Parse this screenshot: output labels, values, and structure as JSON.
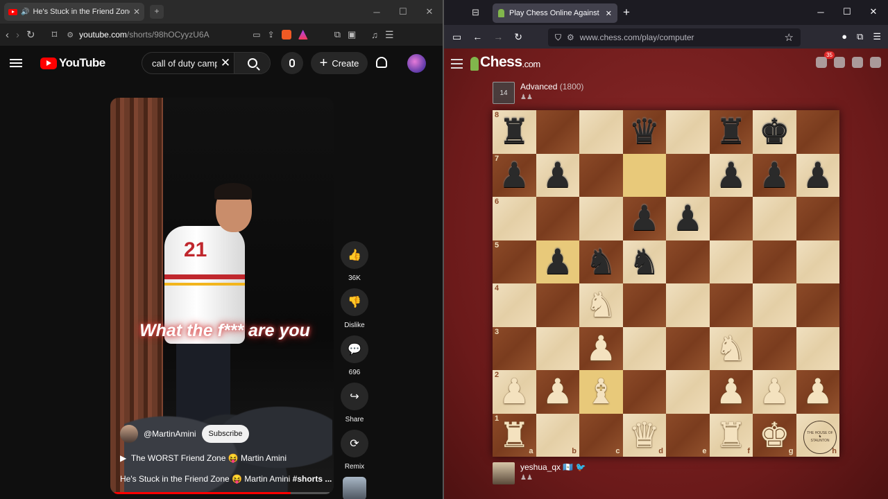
{
  "left_browser": {
    "tab_title": "He's Stuck in the Friend Zone",
    "address_domain": "youtube.com",
    "address_path": "/shorts/98hOCyyzU6A"
  },
  "youtube": {
    "logo_text": "YouTube",
    "search_query": "call of duty camp",
    "create_label": "Create",
    "video": {
      "caption": "What the f*** are you",
      "jersey_number": "21",
      "channel_handle": "@MartinAmini",
      "subscribe_label": "Subscribe",
      "song_line": "The WORST Friend Zone 😝 Martin Amini",
      "title_prefix": "He's Stuck in the Friend Zone 😝 Martin Amini",
      "title_tag": "#shorts ..."
    },
    "actions": [
      {
        "name": "like",
        "label": "36K",
        "glyph": "👍"
      },
      {
        "name": "dislike",
        "label": "Dislike",
        "glyph": "👎"
      },
      {
        "name": "comments",
        "label": "696",
        "glyph": "💬"
      },
      {
        "name": "share",
        "label": "Share",
        "glyph": "↪"
      },
      {
        "name": "remix",
        "label": "Remix",
        "glyph": "⟳"
      }
    ]
  },
  "right_browser": {
    "tab_title": "Play Chess Online Against the C",
    "address_domain": "www.chess.com",
    "address_path": "/play/computer"
  },
  "chess": {
    "logo_text": "Chess",
    "logo_suffix": ".com",
    "notification_count": "35",
    "bot": {
      "name": "Advanced",
      "rating": "(1800)",
      "avatar_text": "14"
    },
    "player": {
      "name": "yeshua_qx",
      "flags": "🇬🇹 🐦"
    },
    "board": [
      [
        "r",
        "",
        "",
        "q",
        "",
        "r",
        "k",
        ""
      ],
      [
        "p",
        "p",
        "",
        "",
        "",
        "p",
        "p",
        "p"
      ],
      [
        "",
        "",
        "",
        "p",
        "p",
        "",
        "",
        ""
      ],
      [
        "",
        "p",
        "n",
        "n",
        "",
        "",
        "",
        ""
      ],
      [
        "",
        "",
        "N",
        "",
        "",
        "",
        "",
        ""
      ],
      [
        "",
        "",
        "P",
        "",
        "",
        "N",
        "",
        ""
      ],
      [
        "P",
        "P",
        "B",
        "",
        "",
        "P",
        "P",
        "P"
      ],
      [
        "R",
        "",
        "",
        "Q",
        "",
        "R",
        "K",
        ""
      ]
    ],
    "highlight_squares": [
      "d7",
      "b5",
      "c2"
    ],
    "ranks": [
      "8",
      "7",
      "6",
      "5",
      "4",
      "3",
      "2",
      "1"
    ],
    "files": [
      "a",
      "b",
      "c",
      "d",
      "e",
      "f",
      "g",
      "h"
    ]
  }
}
